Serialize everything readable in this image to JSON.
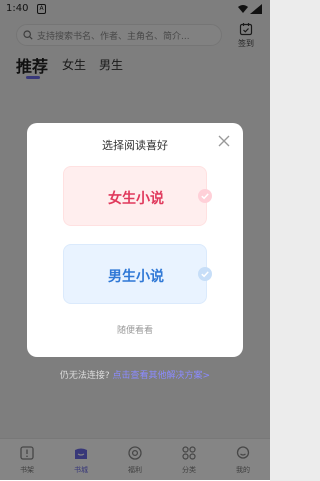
{
  "statusbar": {
    "time": "1:40",
    "sim_badge": "A"
  },
  "search": {
    "placeholder": "支持搜索书名、作者、主角名、简介..."
  },
  "signin": {
    "label": "签到"
  },
  "tabs": [
    {
      "label": "推荐"
    },
    {
      "label": "女生"
    },
    {
      "label": "男生"
    }
  ],
  "modal": {
    "title": "选择阅读喜好",
    "options": [
      {
        "label": "女生小说",
        "color": "#e0395c"
      },
      {
        "label": "男生小说",
        "color": "#2f78d6"
      }
    ],
    "casual": "随便看看"
  },
  "help": {
    "prefix": "仍无法连接?",
    "link": "点击查看其他解决方案>"
  },
  "bottom_nav": [
    {
      "label": "书架",
      "icon": "bookshelf-icon"
    },
    {
      "label": "书城",
      "icon": "bookstore-icon"
    },
    {
      "label": "福利",
      "icon": "welfare-icon"
    },
    {
      "label": "分类",
      "icon": "category-icon"
    },
    {
      "label": "我的",
      "icon": "profile-icon"
    }
  ],
  "colors": {
    "accent": "#6b6be8"
  }
}
